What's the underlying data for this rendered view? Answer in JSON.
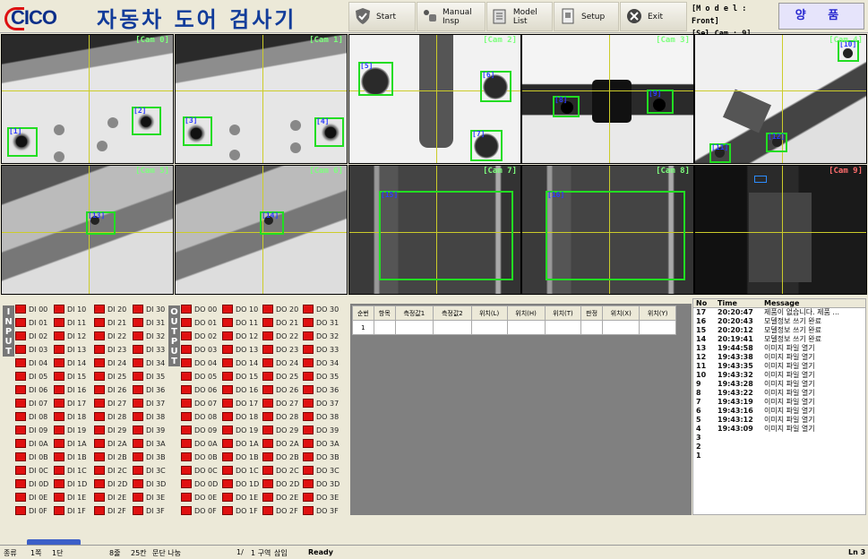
{
  "app": {
    "logo": "CICO",
    "title": "자동차 도어 검사기"
  },
  "toolbar": [
    {
      "label": "Start",
      "icon": "shield-icon"
    },
    {
      "label": "Manual Insp",
      "icon": "hand-icon"
    },
    {
      "label": "Model List",
      "icon": "folder-list-icon"
    },
    {
      "label": "Setup",
      "icon": "document-setup-icon"
    },
    {
      "label": "Exit",
      "icon": "exit-icon"
    }
  ],
  "model": {
    "line1": "[M o d e l : Front]",
    "line2": "[Sel Cam : 9]"
  },
  "judgement": "양 품",
  "cameras": [
    {
      "label": "[Cam 0]",
      "boxes": [
        "[1]",
        "[2]"
      ]
    },
    {
      "label": "[Cam 1]",
      "boxes": [
        "[3]",
        "[4]"
      ]
    },
    {
      "label": "[Cam 2]",
      "boxes": [
        "[5]",
        "[6]",
        "[7]"
      ]
    },
    {
      "label": "[Cam 3]",
      "boxes": [
        "[8]",
        "[9]"
      ]
    },
    {
      "label": "[Cam 4]",
      "boxes": [
        "[10]",
        "[11]",
        "[12]"
      ]
    },
    {
      "label": "[Cam 5]",
      "boxes": [
        "[13]"
      ]
    },
    {
      "label": "[Cam 6]",
      "boxes": [
        "[14]"
      ]
    },
    {
      "label": "[Cam 7]",
      "boxes": [
        "[15]"
      ]
    },
    {
      "label": "[Cam 8]",
      "boxes": [
        "[16]"
      ]
    },
    {
      "label": "[Cam 9]",
      "boxes": []
    }
  ],
  "io": {
    "input_label": "INPUT",
    "output_label": "OUTPUT",
    "di": [
      [
        "DI 00",
        "DI 01",
        "DI 02",
        "DI 03",
        "DI 04",
        "DI 05",
        "DI 06",
        "DI 07",
        "DI 08",
        "DI 09",
        "DI 0A",
        "DI 0B",
        "DI 0C",
        "DI 0D",
        "DI 0E",
        "DI 0F"
      ],
      [
        "DI 10",
        "DI 11",
        "DI 12",
        "DI 13",
        "DI 14",
        "DI 15",
        "DI 16",
        "DI 17",
        "DI 18",
        "DI 19",
        "DI 1A",
        "DI 1B",
        "DI 1C",
        "DI 1D",
        "DI 1E",
        "DI 1F"
      ],
      [
        "DI 20",
        "DI 21",
        "DI 22",
        "DI 23",
        "DI 24",
        "DI 25",
        "DI 26",
        "DI 27",
        "DI 28",
        "DI 29",
        "DI 2A",
        "DI 2B",
        "DI 2C",
        "DI 2D",
        "DI 2E",
        "DI 2F"
      ],
      [
        "DI 30",
        "DI 31",
        "DI 32",
        "DI 33",
        "DI 34",
        "DI 35",
        "DI 36",
        "DI 37",
        "DI 38",
        "DI 39",
        "DI 3A",
        "DI 3B",
        "DI 3C",
        "DI 3D",
        "DI 3E",
        "DI 3F"
      ]
    ],
    "do": [
      [
        "DO 00",
        "DO 01",
        "DO 02",
        "DO 03",
        "DO 04",
        "DO 05",
        "DO 06",
        "DO 07",
        "DO 08",
        "DO 09",
        "DO 0A",
        "DO 0B",
        "DO 0C",
        "DO 0D",
        "DO 0E",
        "DO 0F"
      ],
      [
        "DO 10",
        "DO 11",
        "DO 12",
        "DO 13",
        "DO 14",
        "DO 15",
        "DO 16",
        "DO 17",
        "DO 18",
        "DO 19",
        "DO 1A",
        "DO 1B",
        "DO 1C",
        "DO 1D",
        "DO 1E",
        "DO 1F"
      ],
      [
        "DO 20",
        "DO 21",
        "DO 22",
        "DO 23",
        "DO 24",
        "DO 25",
        "DO 26",
        "DO 27",
        "DO 28",
        "DO 29",
        "DO 2A",
        "DO 2B",
        "DO 2C",
        "DO 2D",
        "DO 2E",
        "DO 2F"
      ],
      [
        "DO 30",
        "DO 31",
        "DO 32",
        "DO 33",
        "DO 34",
        "DO 35",
        "DO 36",
        "DO 37",
        "DO 38",
        "DO 39",
        "DO 3A",
        "DO 3B",
        "DO 3C",
        "DO 3D",
        "DO 3E",
        "DO 3F"
      ]
    ]
  },
  "result_table": {
    "headers": [
      "순번",
      "항목",
      "측정값1",
      "측정값2",
      "위치(L)",
      "위치(H)",
      "위치(T)",
      "판정",
      "위치(X)",
      "위치(Y)"
    ],
    "rows": [
      [
        "1",
        "",
        "",
        "",
        "",
        "",
        "",
        "",
        "",
        ""
      ]
    ]
  },
  "log": {
    "headers": [
      "No",
      "Time",
      "Message"
    ],
    "rows": [
      [
        "17",
        "20:20:47",
        "제품이 없습니다. 제품 ..."
      ],
      [
        "16",
        "20:20:43",
        "모델정보 쓰기 완료"
      ],
      [
        "15",
        "20:20:12",
        "모델정보 쓰기 완료"
      ],
      [
        "14",
        "20:19:41",
        "모델정보 쓰기 완료"
      ],
      [
        "13",
        "19:44:58",
        "이미지 파일 열기"
      ],
      [
        "12",
        "19:43:38",
        "이미지 파일 열기"
      ],
      [
        "11",
        "19:43:35",
        "이미지 파일 열기"
      ],
      [
        "10",
        "19:43:32",
        "이미지 파일 열기"
      ],
      [
        "9",
        "19:43:28",
        "이미지 파일 열기"
      ],
      [
        "8",
        "19:43:22",
        "이미지 파일 열기"
      ],
      [
        "7",
        "19:43:19",
        "이미지 파일 열기"
      ],
      [
        "6",
        "19:43:16",
        "이미지 파일 열기"
      ],
      [
        "5",
        "19:43:12",
        "이미지 파일 열기"
      ],
      [
        "4",
        "19:43:09",
        "이미지 파일 열기"
      ],
      [
        "3",
        "",
        ""
      ],
      [
        "2",
        "",
        ""
      ],
      [
        "1",
        "",
        ""
      ]
    ]
  },
  "statusbar": {
    "a": "종류",
    "b": "1쪽",
    "c": "1단",
    "d": "8줄",
    "e": "25칸",
    "f": "문단 나눔",
    "g": "1/",
    "h": "1 구역",
    "i": "삽입",
    "status": "Ready",
    "right": "Ln 3"
  }
}
